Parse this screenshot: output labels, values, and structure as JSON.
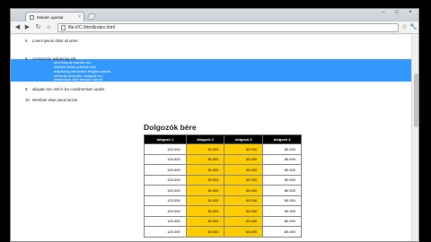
{
  "tab": {
    "title": "Minden ajanlat"
  },
  "address": {
    "url": "file:///C:/html/index.html"
  },
  "list": [
    {
      "num": "6.",
      "text": "Lorem ipsum dolor sit amet"
    },
    {
      "num": "8.",
      "text": "consectetur adipiscing elit"
    },
    {
      "num": "9.",
      "text": "aliquam nec nisl in leo condimentum iaculis"
    },
    {
      "num": "10.",
      "text": "interdum vitae purus luctus"
    }
  ],
  "sublist": [
    "sed tempus mauris non",
    "ultricies tellus pulvinar nec",
    "adipiscing nisl luctus fringilla lacinia",
    "vehicula molestie, volutpat nec",
    "vestibulum nibh tempor rutrum"
  ],
  "table": {
    "title": "Dolgozók bére",
    "headers": [
      "dolgozó 1",
      "dolgozó 2",
      "dolgozó 3",
      "dolgozó 4"
    ],
    "rows": [
      [
        "120.000",
        "35.000",
        "65.000",
        "80.000"
      ],
      [
        "120.000",
        "35.000",
        "65.000",
        "80.000"
      ],
      [
        "120.000",
        "35.000",
        "65.000",
        "80.000"
      ],
      [
        "120.000",
        "35.000",
        "65.000",
        "80.000"
      ],
      [
        "120.000",
        "35.000",
        "65.000",
        "80.000"
      ],
      [
        "120.000",
        "35.000",
        "65.000",
        "80.000"
      ],
      [
        "120.000",
        "35.000",
        "65.000",
        "80.000"
      ],
      [
        "120.000",
        "35.000",
        "65.000",
        "80.000"
      ],
      [
        "120.000",
        "35.000",
        "65.000",
        "80.000"
      ]
    ]
  },
  "colors": {
    "selection": "#3399ff",
    "highlight": "#ffcc00",
    "header": "#000000"
  },
  "icons": [
    "back-icon",
    "forward-icon",
    "reload-icon",
    "home-icon",
    "page-icon",
    "star-icon",
    "wrench-icon"
  ]
}
